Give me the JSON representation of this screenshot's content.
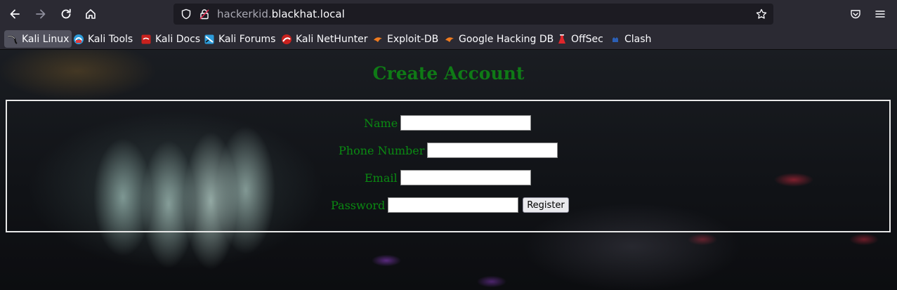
{
  "browser": {
    "url_subdomain": "hackerkid.",
    "url_domain": "blackhat.local",
    "icons": [
      "back-icon",
      "forward-icon",
      "reload-icon",
      "home-icon",
      "shield-icon",
      "lock-icon",
      "star-icon",
      "pocket-icon",
      "menu-icon"
    ]
  },
  "bookmarks": [
    {
      "label": "Kali Linux",
      "icon": "kali-dragon-icon",
      "color": "#2d9cdb"
    },
    {
      "label": "Kali Tools",
      "icon": "kali-tools-icon",
      "color": "#e23a3a"
    },
    {
      "label": "Kali Docs",
      "icon": "kali-docs-icon",
      "color": "#c9211e"
    },
    {
      "label": "Kali Forums",
      "icon": "kali-forums-icon",
      "color": "#2d9cdb"
    },
    {
      "label": "Kali NetHunter",
      "icon": "nethunter-icon",
      "color": "#c9211e"
    },
    {
      "label": "Exploit-DB",
      "icon": "exploit-db-icon",
      "color": "#f07b1f"
    },
    {
      "label": "Google Hacking DB",
      "icon": "ghdb-icon",
      "color": "#f07b1f"
    },
    {
      "label": "OffSec",
      "icon": "offsec-icon",
      "color": "#e0262b"
    },
    {
      "label": "Clash",
      "icon": "clash-icon",
      "color": "#2b5fb5"
    }
  ],
  "page": {
    "title": "Create Account",
    "fields": {
      "name_label": "Name",
      "phone_label": "Phone Number",
      "email_label": "Email",
      "password_label": "Password",
      "name_value": "",
      "phone_value": "",
      "email_value": "",
      "password_value": ""
    },
    "register_label": "Register"
  },
  "colors": {
    "title": "#0f7a16",
    "label": "#0a8a12",
    "border": "#e8e8e8"
  }
}
